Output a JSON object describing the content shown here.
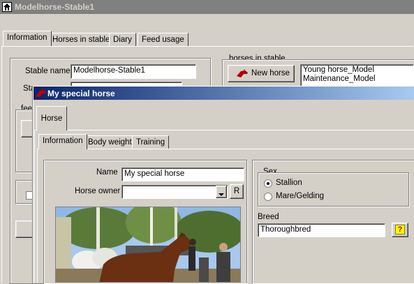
{
  "main_window": {
    "title": "Modelhorse-Stable1",
    "tabs": [
      "Information",
      "Horses in stable",
      "Diary",
      "Feed usage"
    ],
    "stable_name_label": "Stable name",
    "stable_name_value": "Modelhorse-Stable1",
    "stable_owner_label_partial": "Sta",
    "feed_group_partial": "fee",
    "horses_group_label": "horses in stable",
    "new_horse_button": "New horse",
    "horse_list": [
      "Young horse_Model",
      "Maintenance_Model"
    ]
  },
  "dialog": {
    "title": "My special horse",
    "outer_tab": "Horse",
    "tabs": [
      "Information",
      "Body weight",
      "Training"
    ],
    "name_label": "Name",
    "name_value": "My special horse",
    "owner_label": "Horse owner",
    "owner_value": "",
    "owner_r_button": "R",
    "sex_group_label": "Sex",
    "sex_options": [
      "Stallion",
      "Mare/Gelding"
    ],
    "sex_selected": "Stallion",
    "breed_label": "Breed",
    "breed_value": "Thoroughbred",
    "help_button": "?"
  },
  "icons": {
    "window_icon": "house-icon",
    "new_horse_icon": "horse-head-icon",
    "dialog_icon": "horse-head-icon",
    "dropdown": "chevron-down-icon"
  },
  "colors": {
    "dialog_title_start": "#0a246a",
    "dialog_title_end": "#a6caf0",
    "inactive_title": "#808080",
    "help_button_bg": "#ffff00"
  }
}
